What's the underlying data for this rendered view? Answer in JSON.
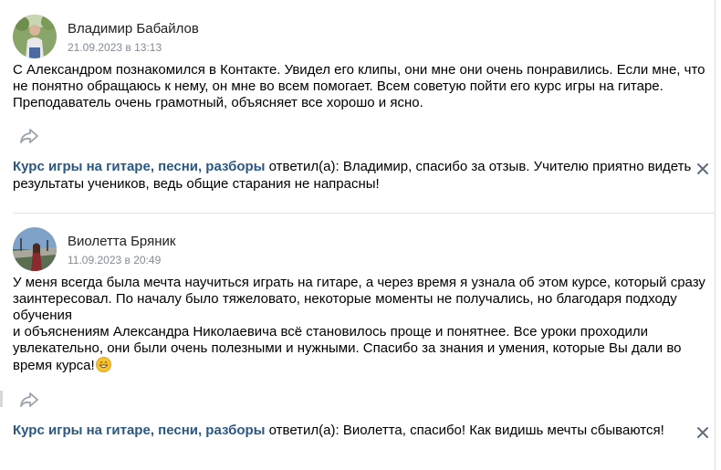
{
  "reviews": [
    {
      "author": "Владимир Бабайлов",
      "date": "21.09.2023 в 13:13",
      "text": "С Александром познакомился в Контакте. Увидел его клипы, они мне они очень понравились. Если мне, что не понятно обращаюсь к нему, он мне во всем помогает. Всем советую пойти его курс игры на гитаре. Преподаватель очень грамотный, объясняет все хорошо и ясно.",
      "reply": {
        "group": "Курс игры на гитаре, песни, разборы",
        "verb": " ответил(а): ",
        "text": "Владимир, спасибо за отзыв. Учителю приятно видеть результаты учеников, ведь общие старания не напрасны!"
      }
    },
    {
      "author": "Виолетта Бряник",
      "date": "11.09.2023 в 20:49",
      "text": "У меня всегда была мечта научиться играть на гитаре, а через время я узнала об этом курсе, который сразу заинтересовал. По началу было тяжеловато, некоторые моменты не получались, но благодаря подходу обучения\nи объяснениям Александра Николаевича всё становилось проще и понятнее. Все уроки проходили увлекательно, они были очень полезными и нужными. Спасибо за знания и умения, которые Вы дали во время курса!",
      "reply": {
        "group": "Курс игры на гитаре, песни, разборы",
        "verb": " ответил(а): ",
        "text": "Виолетта, спасибо! Как видишь мечты сбываются!"
      }
    }
  ],
  "icons": {
    "share": "share-arrow-icon",
    "close": "close-icon",
    "emoji": "grinning-face-emoji"
  },
  "colors": {
    "link": "#2a5885",
    "date": "#818c99",
    "divider": "#e3e4e8"
  }
}
